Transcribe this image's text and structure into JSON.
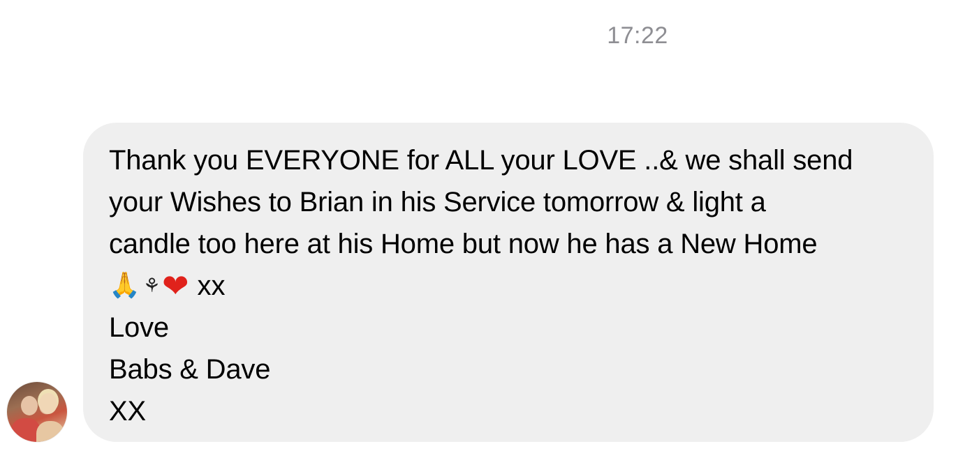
{
  "thread": {
    "timestamp": "17:22"
  },
  "message": {
    "lines": [
      "Thank you EVERYONE for ALL your LOVE ..& we shall send",
      "your Wishes to Brian in his Service tomorrow & light a",
      "candle too here at his Home but now he has a New Home"
    ],
    "emojis": {
      "pray": "🙏",
      "flower": "⚘",
      "heart": "❤"
    },
    "emoji_suffix": "xx",
    "signoff": [
      "Love",
      "Babs & Dave",
      "XX"
    ]
  },
  "colors": {
    "bubble_bg": "#efefef",
    "timestamp": "#8e8e93",
    "text": "#000000"
  }
}
